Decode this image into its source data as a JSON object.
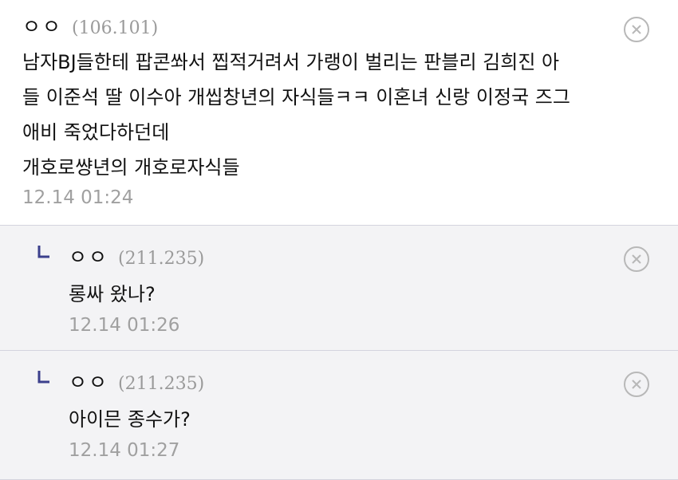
{
  "comments": [
    {
      "nick": "ㅇㅇ",
      "ip": "(106.101)",
      "lines": [
        "남자BJ들한테 팝콘쏴서 찝적거려서 가랭이 벌리는 판블리 김희진 아",
        "들 이준석 딸 이수아 개씹창년의 자식들ㅋㅋ 이혼녀 신랑 이정국 즈그",
        "애비 죽었다하던데",
        "개호로썅년의 개호로자식들"
      ],
      "date": "12.14 01:24"
    },
    {
      "nick": "ㅇㅇ",
      "ip": "(211.235)",
      "text": "롱싸 왔나?",
      "date": "12.14 01:26"
    },
    {
      "nick": "ㅇㅇ",
      "ip": "(211.235)",
      "text": "아이믄 종수가?",
      "date": "12.14 01:27"
    }
  ],
  "colors": {
    "reply_bg": "#f3f3f5",
    "divider": "#d4d4de",
    "reply_arrow": "#3b3f8c",
    "meta_text": "#a0a0a0"
  },
  "icons": {
    "delete": "close-circle-icon",
    "reply": "reply-arrow-icon"
  }
}
